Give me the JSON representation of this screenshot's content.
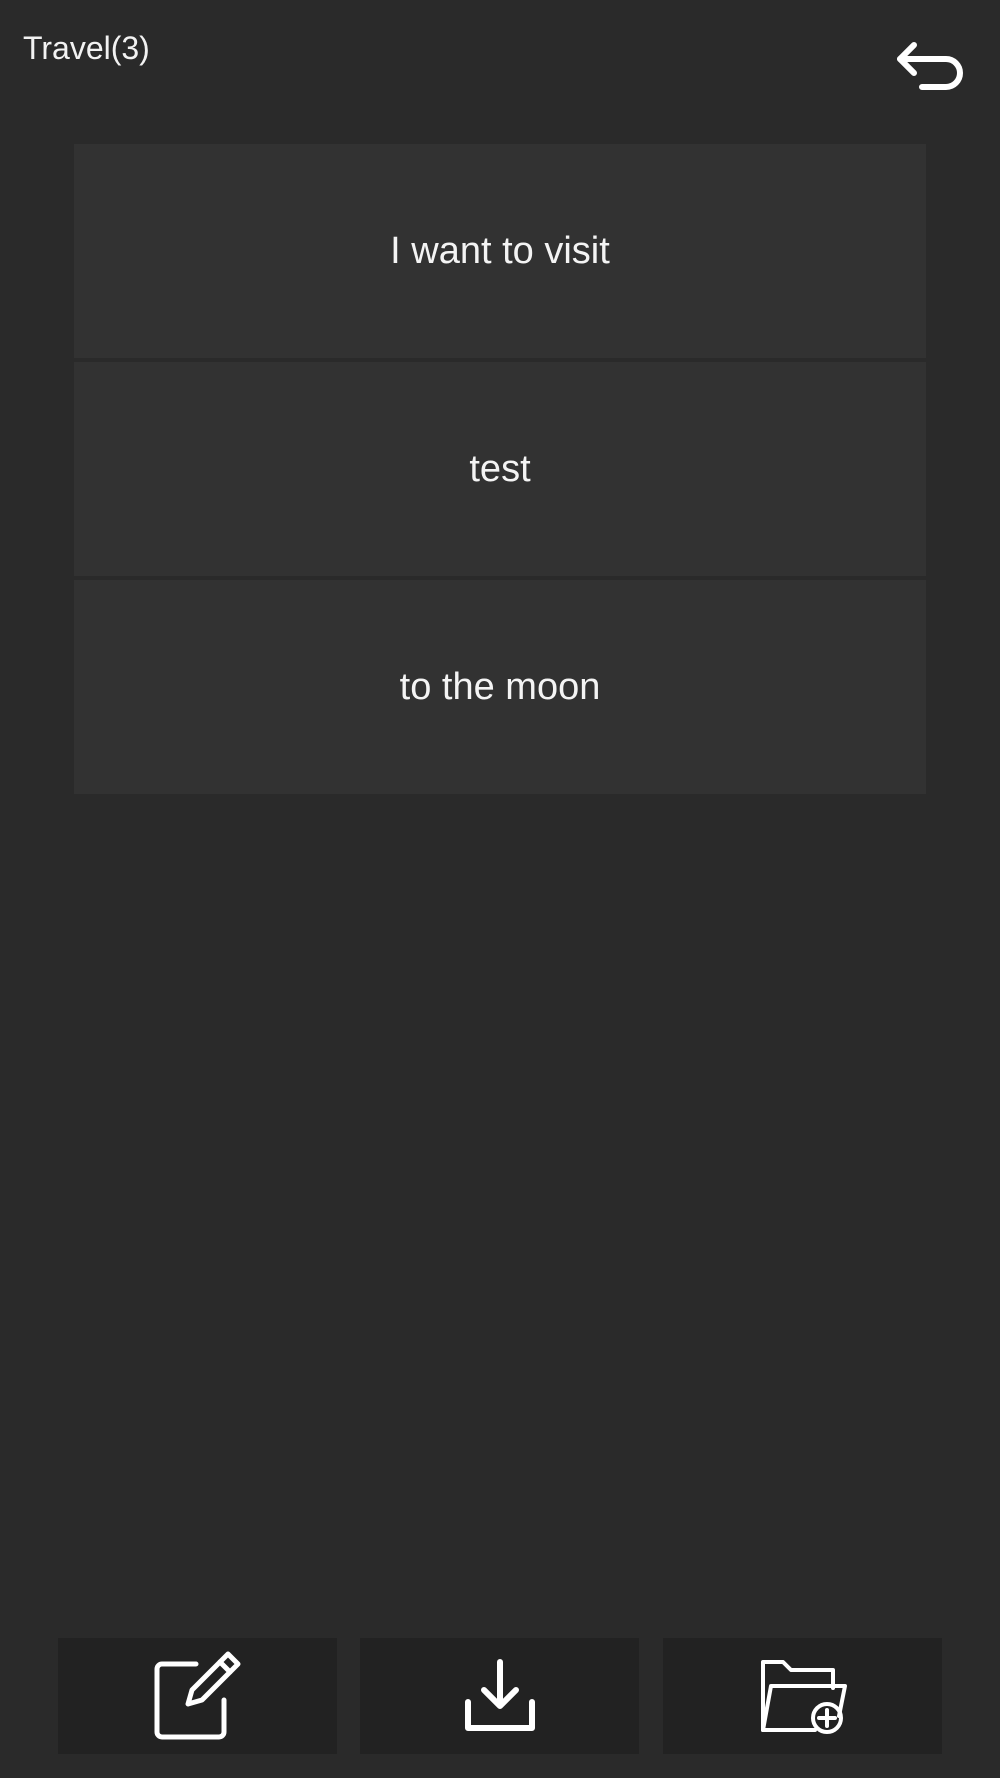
{
  "header": {
    "title": "Travel(3)",
    "back_icon": "undo-arrow-icon"
  },
  "items": [
    {
      "label": "I want to visit"
    },
    {
      "label": "test"
    },
    {
      "label": "to the moon"
    }
  ],
  "toolbar": {
    "buttons": [
      {
        "icon": "edit-icon"
      },
      {
        "icon": "download-icon"
      },
      {
        "icon": "folder-add-icon"
      }
    ]
  },
  "colors": {
    "background": "#2a2a2a",
    "item_background": "#323232",
    "toolbar_button_background": "#222222",
    "text": "#ffffff"
  }
}
